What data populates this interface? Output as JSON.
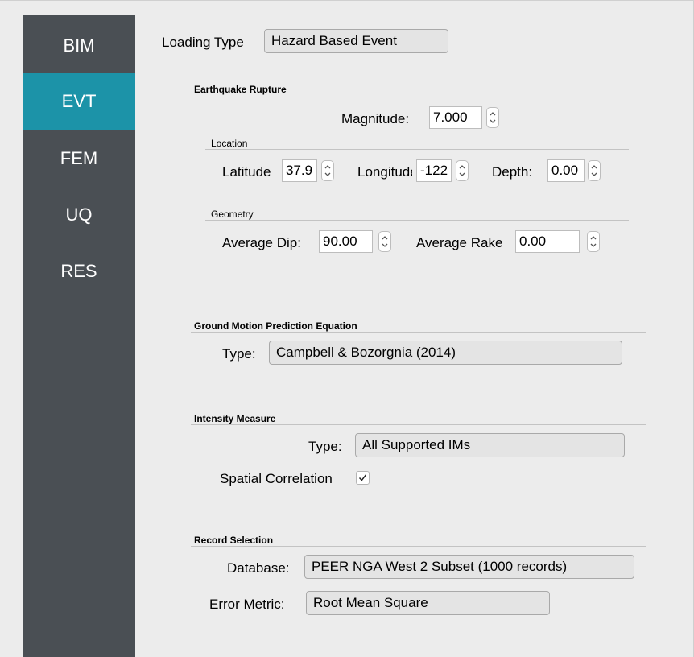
{
  "sidebar": {
    "items": [
      {
        "label": "BIM",
        "active": false
      },
      {
        "label": "EVT",
        "active": true
      },
      {
        "label": "FEM",
        "active": false
      },
      {
        "label": "UQ",
        "active": false
      },
      {
        "label": "RES",
        "active": false
      }
    ],
    "active_color": "#1c93a8",
    "background_color": "#4a4f54"
  },
  "loading": {
    "label": "Loading Type",
    "value": "Hazard Based Event"
  },
  "earthquake_rupture": {
    "title": "Earthquake Rupture",
    "magnitude": {
      "label": "Magnitude:",
      "value": "7.000"
    },
    "location": {
      "title": "Location",
      "latitude": {
        "label": "Latitude",
        "value": "37.9"
      },
      "longitude": {
        "label": "Longitude",
        "value": "-122"
      },
      "depth": {
        "label": "Depth:",
        "value": "0.00"
      }
    },
    "geometry": {
      "title": "Geometry",
      "dip": {
        "label": "Average Dip:",
        "value": "90.00"
      },
      "rake": {
        "label": "Average Rake",
        "value": "0.00"
      }
    }
  },
  "gmpe": {
    "title": "Ground Motion Prediction Equation",
    "type_label": "Type:",
    "type_value": "Campbell & Bozorgnia (2014)"
  },
  "intensity": {
    "title": "Intensity Measure",
    "type_label": "Type:",
    "type_value": "All Supported IMs",
    "spatial_label": "Spatial Correlation",
    "spatial_checked": true
  },
  "record": {
    "title": "Record Selection",
    "database_label": "Database:",
    "database_value": "PEER NGA West 2 Subset (1000 records)",
    "error_label": "Error Metric:",
    "error_value": "Root Mean Square"
  }
}
